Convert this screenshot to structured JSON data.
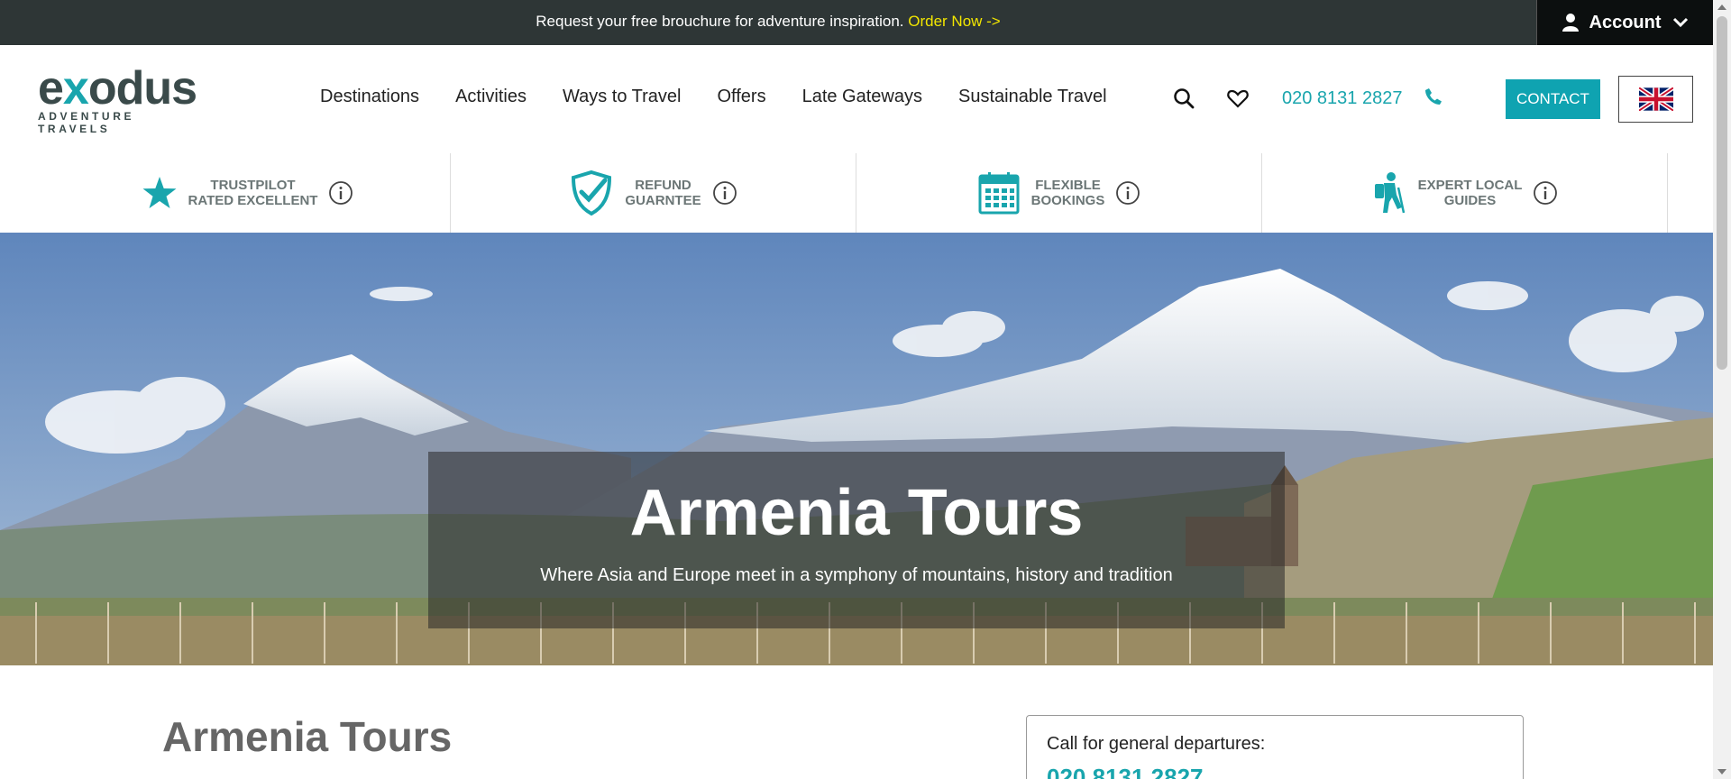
{
  "promo": {
    "text": "Request your free brouchure for adventure inspiration.",
    "link": "Order Now ->"
  },
  "account": {
    "label": "Account"
  },
  "logo": {
    "main_a": "e",
    "main_x": "x",
    "main_b": "odus",
    "sub": "ADVENTURE TRAVELS"
  },
  "nav": {
    "items": [
      "Destinations",
      "Activities",
      "Ways to Travel",
      "Offers",
      "Late Gateways",
      "Sustainable Travel"
    ]
  },
  "header": {
    "phone": "020 8131 2827",
    "contact_label": "CONTACT",
    "language": "UK flag"
  },
  "usp": [
    {
      "line1": "TRUSTPILOT",
      "line2": "RATED EXCELLENT",
      "icon": "star-icon"
    },
    {
      "line1": "REFUND",
      "line2": "GUARNTEE",
      "icon": "shield-check-icon"
    },
    {
      "line1": "FLEXIBLE",
      "line2": "BOOKINGS",
      "icon": "calendar-icon"
    },
    {
      "line1": "EXPERT LOCAL",
      "line2": "GUIDES",
      "icon": "hiker-icon"
    }
  ],
  "hero": {
    "title": "Armenia Tours",
    "subtitle": "Where Asia and Europe meet in a symphony of mountains, history and tradition"
  },
  "main": {
    "title": "Armenia Tours",
    "call_label": "Call for general departures:",
    "call_number": "020 8131 2827"
  },
  "colors": {
    "accent": "#19a5ad",
    "promo_bg": "#2e3636",
    "promo_link": "#f2e600"
  }
}
